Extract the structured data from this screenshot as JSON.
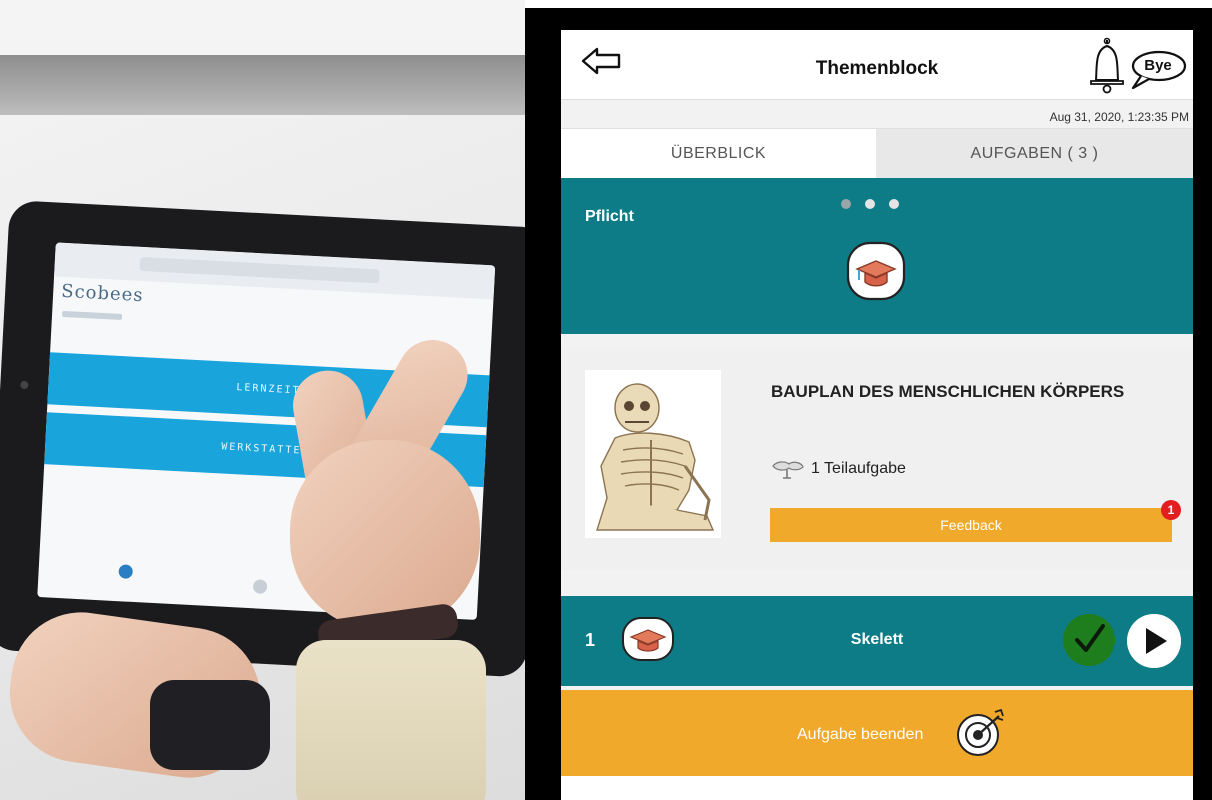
{
  "left_photo": {
    "tablet_app_logo": "Scobees",
    "tablet_buttons": [
      "LERNZEIT",
      "WERKSTATTEN"
    ]
  },
  "header": {
    "title": "Themenblock",
    "bye_label": "Bye",
    "timestamp": "Aug 31, 2020, 1:23:35 PM"
  },
  "tabs": [
    {
      "label": "ÜBERBLICK",
      "active": true
    },
    {
      "label": "AUFGABEN ( 3 )",
      "active": false
    }
  ],
  "hero": {
    "label": "Pflicht",
    "page_dots": 3,
    "active_dot": 1
  },
  "card": {
    "title": "BAUPLAN DES MENSCHLICHEN KÖRPERS",
    "subtask_text": "1 Teilaufgabe",
    "feedback_label": "Feedback",
    "feedback_badge": "1"
  },
  "task": {
    "number": "1",
    "name": "Skelett",
    "completed": true
  },
  "finish": {
    "label": "Aufgabe beenden"
  },
  "colors": {
    "teal": "#0e7c86",
    "orange": "#f1a92b",
    "badge_red": "#e21f1f",
    "check_green": "#1e7e1e"
  }
}
